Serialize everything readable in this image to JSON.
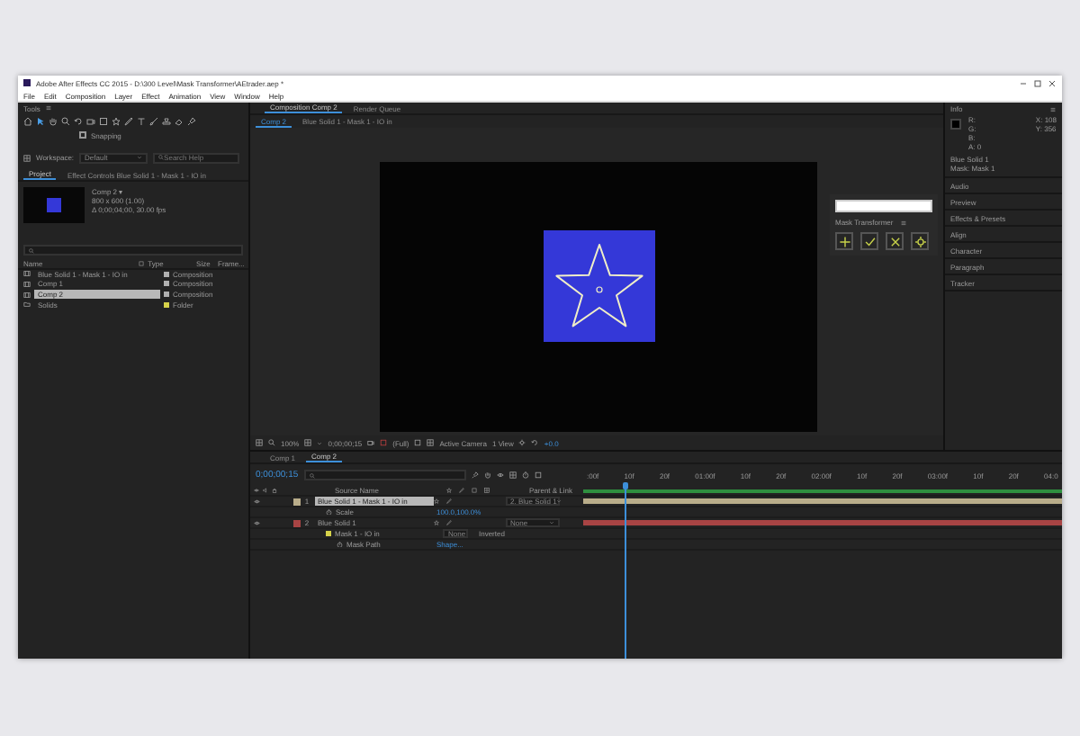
{
  "window": {
    "title": "Adobe After Effects CC 2015 - D:\\300 Level\\Mask Transformer\\AEtrader.aep *"
  },
  "menu": [
    "File",
    "Edit",
    "Composition",
    "Layer",
    "Effect",
    "Animation",
    "View",
    "Window",
    "Help"
  ],
  "tools": {
    "title": "Tools",
    "snapping": {
      "label": "Snapping",
      "checked": false
    }
  },
  "workspace": {
    "label": "Workspace:",
    "value": "Default",
    "search_placeholder": "Search Help"
  },
  "project": {
    "tabs": [
      {
        "label": "Project",
        "selected": true
      },
      {
        "label": "Effect Controls Blue Solid 1 - Mask 1 - IO in",
        "selected": false
      }
    ],
    "preview": {
      "name": "Comp 2 ▾",
      "lines": [
        "800 x 600 (1.00)",
        "Δ 0;00;04;00, 30.00 fps"
      ]
    },
    "columns": [
      "Name",
      "Type",
      "Size",
      "Frame..."
    ],
    "items": [
      {
        "name": "Blue Solid 1 - Mask 1 - IO in",
        "type": "Composition",
        "kind": "composition",
        "color": "#b0b0b0",
        "selected": false
      },
      {
        "name": "Comp 1",
        "type": "Composition",
        "kind": "composition",
        "color": "#b0b0b0",
        "selected": false
      },
      {
        "name": "Comp 2",
        "type": "Composition",
        "kind": "composition",
        "color": "#b0b0b0",
        "selected": true
      },
      {
        "name": "Solids",
        "type": "Folder",
        "kind": "folder",
        "color": "#d6d24a",
        "selected": false
      }
    ]
  },
  "composition": {
    "tabs": [
      {
        "label": "Composition Comp 2",
        "selected": true
      },
      {
        "label": "Render Queue",
        "selected": false
      }
    ],
    "subtabs": [
      {
        "label": "Comp 2",
        "selected": true
      },
      {
        "label": "Blue Solid 1 - Mask 1 - IO in",
        "selected": false
      }
    ],
    "toolbar": {
      "zoom": "100%",
      "time": "0;00;00;15",
      "resolution": "(Full)",
      "camera": "Active Camera",
      "views": "1 View",
      "exposure": "+0.0"
    }
  },
  "mask_transformer": {
    "title": "Mask Transformer"
  },
  "info": {
    "title": "Info",
    "channels": [
      "R:",
      "G:",
      "B:",
      "A: 0"
    ],
    "coords": [
      "X: 108",
      "Y: 356"
    ],
    "lines": [
      "Blue Solid 1",
      "Mask: Mask 1"
    ]
  },
  "panels": [
    "Audio",
    "Preview",
    "Effects & Presets",
    "Align",
    "Character",
    "Paragraph",
    "Tracker"
  ],
  "timeline": {
    "tabs": [
      {
        "label": "Comp 1",
        "selected": false
      },
      {
        "label": "Comp 2",
        "selected": true
      }
    ],
    "timecode": "0;00;00;15",
    "source_column": "Source Name",
    "parent_column": "Parent & Link",
    "ruler": [
      ":00f",
      "10f",
      "20f",
      "01:00f",
      "10f",
      "20f",
      "02:00f",
      "10f",
      "20f",
      "03:00f",
      "10f",
      "20f",
      "04:0"
    ],
    "playhead": {
      "level": 0.09
    },
    "layers": [
      {
        "kind": "layer",
        "number": "1",
        "name": "Blue Solid 1 - Mask 1 - IO in",
        "color": "#b9ad8a",
        "selected": true,
        "parent": "2. Blue Solid 1",
        "children": [
          {
            "kind": "property",
            "name": "Scale",
            "value": "100.0,100.0%"
          }
        ]
      },
      {
        "kind": "layer",
        "number": "2",
        "name": "Blue Solid 1",
        "color": "#a84444",
        "selected": false,
        "parent": "None",
        "children": [
          {
            "kind": "mask",
            "name": "Mask 1 - IO in",
            "color": "#d6d24a",
            "mode": "None",
            "extra": "Inverted",
            "children": [
              {
                "kind": "property",
                "name": "Mask Path",
                "value": "Shape..."
              }
            ]
          }
        ]
      }
    ]
  }
}
